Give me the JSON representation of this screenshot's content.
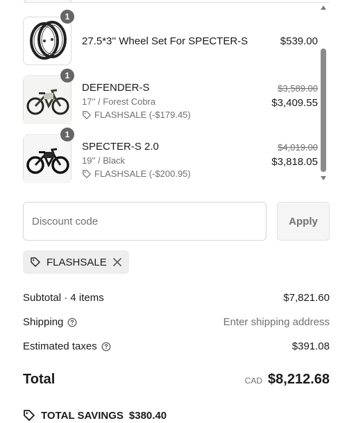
{
  "cart": {
    "items": [
      {
        "name": "27.5*3'' Wheel Set For SPECTER-S",
        "quantity": "1",
        "price": "$539.00",
        "thumbnail_icon": "wheel-set-image"
      },
      {
        "name": "DEFENDER-S",
        "quantity": "1",
        "variant": "17'' / Forest Cobra",
        "discount": "FLASHSALE (-$179.45)",
        "original_price": "$3,589.00",
        "price": "$3,409.55",
        "thumbnail_icon": "ebike-image"
      },
      {
        "name": "SPECTER-S 2.0",
        "quantity": "1",
        "variant": "19'' / Black",
        "discount": "FLASHSALE (-$200.95)",
        "original_price": "$4,019.00",
        "price": "$3,818.05",
        "thumbnail_icon": "ebike-image"
      }
    ]
  },
  "discount": {
    "placeholder": "Discount code",
    "value": "",
    "apply_label": "Apply",
    "applied_code": "FLASHSALE"
  },
  "summary": {
    "subtotal_label": "Subtotal · 4 items",
    "subtotal_value": "$7,821.60",
    "shipping_label": "Shipping",
    "shipping_value": "Enter shipping address",
    "taxes_label": "Estimated taxes",
    "taxes_value": "$391.08",
    "total_label": "Total",
    "currency": "CAD",
    "total_value": "$8,212.68",
    "savings_label": "TOTAL SAVINGS",
    "savings_value": "$380.40"
  },
  "icons": {
    "tag": "tag-icon",
    "remove": "close-icon",
    "help": "help-circle-icon",
    "scroll_up": "chevron-up-icon",
    "scroll_down": "chevron-down-icon"
  },
  "colors": {
    "badge": "#666666",
    "muted_text": "#707070",
    "chip_background": "#eeeeee",
    "apply_background": "#f5f5f5"
  }
}
